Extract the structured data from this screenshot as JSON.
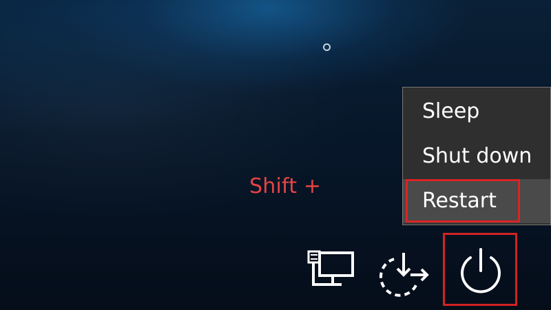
{
  "screen": {
    "hint": "Shift +",
    "colors": {
      "hint": "#e74343",
      "highlight": "#da2424",
      "menu_background": "#2f2f2f",
      "menu_selected_background": "#4a4a4a",
      "text": "#ffffff"
    }
  },
  "status": {
    "loading_icon": "circle-loading-icon"
  },
  "power_menu": {
    "items": [
      {
        "label": "Sleep"
      },
      {
        "label": "Shut down"
      },
      {
        "label": "Restart",
        "selected": true
      }
    ]
  },
  "bottom_icons": {
    "network_icon": "network-icon",
    "accessibility_icon": "accessibility-icon",
    "power_icon": "power-icon"
  }
}
